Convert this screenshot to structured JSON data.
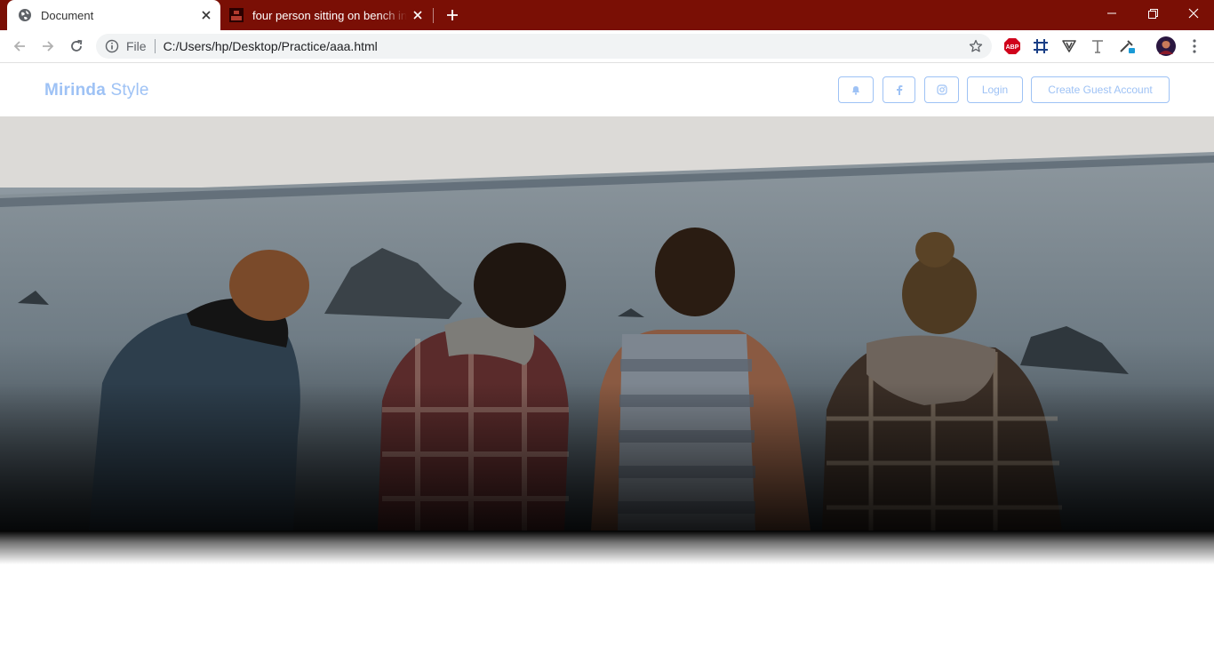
{
  "browser": {
    "tabs": [
      {
        "title": "Document",
        "active": true,
        "icon": "globe-icon"
      },
      {
        "title": "four person sitting on bench in front",
        "active": false,
        "icon": "unsplash-icon"
      }
    ],
    "address": {
      "scheme_label": "File",
      "url": "C:/Users/hp/Desktop/Practice/aaa.html"
    },
    "extensions": [
      "abp-icon",
      "grid-extension-icon",
      "vee-extension-icon",
      "text-extension-icon",
      "eyedropper-extension-icon",
      "profile-avatar"
    ],
    "extension_labels": {
      "abp": "ABP"
    },
    "accent_color": "#7a0f05"
  },
  "site": {
    "brand_bold": "Mirinda",
    "brand_light": " Style",
    "brand_color": "#9ec2f5",
    "nav": {
      "notifications_icon": "bell-icon",
      "facebook_icon": "facebook-icon",
      "instagram_icon": "instagram-icon",
      "login_label": "Login",
      "create_account_label": "Create Guest Account"
    },
    "hero": {
      "image": "four people seen from behind sitting on a ledge facing the sea"
    }
  }
}
